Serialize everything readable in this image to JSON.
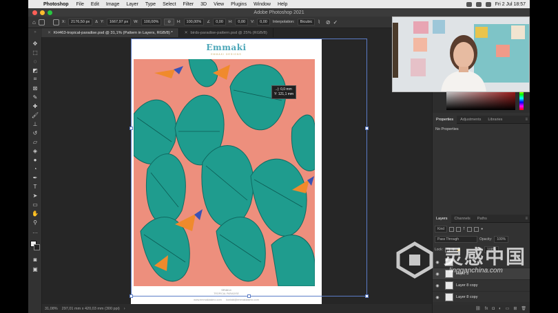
{
  "menubar": {
    "app_name": "Photoshop",
    "items": [
      "File",
      "Edit",
      "Image",
      "Layer",
      "Type",
      "Select",
      "Filter",
      "3D",
      "View",
      "Plugins",
      "Window",
      "Help"
    ],
    "clock": "Fri 2 Jul  18:57"
  },
  "window": {
    "title": "Adobe Photoshop 2021"
  },
  "options": {
    "x_label": "X:",
    "x_value": "2176,50 px",
    "y_label": "Y:",
    "y_value": "1667,97 px",
    "w_label": "W:",
    "w_value": "100,00%",
    "h_label": "H:",
    "h_value": "100,00%",
    "angle_value": "0,00",
    "hskew_label": "H:",
    "hskew_value": "0,00",
    "vskew_label": "V:",
    "vskew_value": "0,00",
    "interp_label": "Interpolation:",
    "interp_value": "Bicubic"
  },
  "tabs": [
    {
      "label": "KH463-tropical-paradise.psd @ 31,1% (Pattern in Layers, RGB/8) *",
      "active": true
    },
    {
      "label": "birds-paradise-pattern.psd @ 25% (RGB/8)",
      "active": false
    }
  ],
  "artboard": {
    "brand": "Emmaki",
    "brand_sub": "EMMAKI DESIGNS",
    "footer_line1": "SR4614",
    "footer_line2": "TROPICAL PARADISE",
    "footer_website": "www.emmakiasimo.com",
    "footer_email": "kontakt@emmakiasimo.com"
  },
  "tooltip": {
    "line1": "→|: 0,0 mm",
    "line2": "Y: 121,1 mm"
  },
  "status": {
    "zoom": "31,08%",
    "doc_size": "297,01 mm x 420,03 mm (300 ppi)"
  },
  "properties": {
    "tabs": [
      "Properties",
      "Adjustments",
      "Libraries"
    ],
    "body": "No Properties"
  },
  "layers": {
    "tabs": [
      "Layers",
      "Channels",
      "Paths"
    ],
    "filter": "Kind",
    "blend_mode": "Pass Through",
    "opacity_label": "Opacity:",
    "opacity_value": "100%",
    "lock_label": "Lock:",
    "fill_label": "Fill:",
    "fill_value": "100%",
    "rows": [
      "Layer 8",
      "Layer 8 copy",
      "Layer 8 copy"
    ]
  },
  "watermark": {
    "text": "灵感中国",
    "url": "lingganchina.com"
  },
  "colors": {
    "pattern_bg": "#ed8f7d",
    "leaf": "#1f9c8e",
    "leaf_dark": "#0f6a62",
    "selection": "#5b7cc7"
  }
}
